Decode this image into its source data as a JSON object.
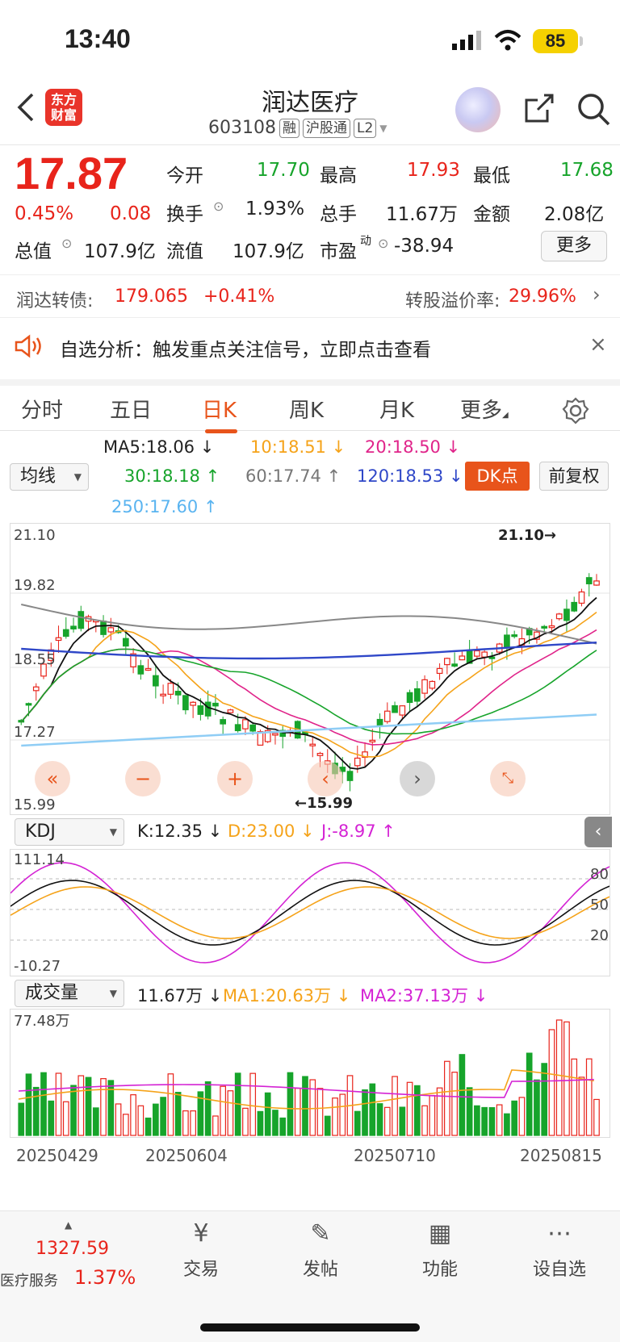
{
  "status": {
    "time": "13:40",
    "battery": "85"
  },
  "header": {
    "logo": [
      "东方",
      "财富"
    ],
    "title": "润达医疗",
    "code": "603108",
    "tags": [
      "融",
      "沪股通",
      "L2"
    ]
  },
  "quote": {
    "price": "17.87",
    "pct": "0.45%",
    "chg": "0.08",
    "open_l": "今开",
    "open": "17.70",
    "high_l": "最高",
    "high": "17.93",
    "low_l": "最低",
    "low": "17.68",
    "turn_l": "换手",
    "turn": "1.93%",
    "vol_l": "总手",
    "vol": "11.67万",
    "amt_l": "金额",
    "amt": "2.08亿",
    "mcap_l": "总值",
    "mcap": "107.9亿",
    "float_l": "流值",
    "float": "107.9亿",
    "pe_l": "市盈",
    "pe_sup": "动",
    "pe": "-38.94",
    "more": "更多"
  },
  "bond": {
    "name": "润达转债:",
    "price": "179.065",
    "chg": "+0.41%",
    "prem_l": "转股溢价率:",
    "prem": "29.96%"
  },
  "alert": {
    "text": "自选分析：触发重点关注信号，立即点击查看"
  },
  "tabs": [
    "分时",
    "五日",
    "日K",
    "周K",
    "月K",
    "更多"
  ],
  "ma": {
    "select": "均线",
    "ma5": "MA5:18.06",
    "ma10": "10:18.51",
    "ma20": "20:18.50",
    "ma30": "30:18.18",
    "ma60": "60:17.74",
    "ma120": "120:18.53",
    "ma250": "250:17.60",
    "dk": "DK点",
    "fq": "前复权"
  },
  "kchart": {
    "ymax": "21.10",
    "y2": "19.82",
    "y3": "18.55",
    "y4": "17.27",
    "ymin": "15.99",
    "hi_lbl": "21.10→",
    "lo_lbl": "←15.99"
  },
  "kdj": {
    "select": "KDJ",
    "k": "K:12.35",
    "d": "D:23.00",
    "j": "J:-8.97",
    "ymax": "111.14",
    "ymin": "-10.27",
    "l80": "80",
    "l50": "50",
    "l20": "20"
  },
  "vol": {
    "select": "成交量",
    "v": "11.67万",
    "ma1": "MA1:20.63万",
    "ma2": "MA2:37.13万",
    "ymax": "77.48万"
  },
  "dates": [
    "20250429",
    "20250604",
    "20250710",
    "20250815"
  ],
  "bottom": {
    "index_val": "1327.59",
    "index_name": "医疗服务",
    "index_pct": "1.37%",
    "items": [
      "交易",
      "发帖",
      "功能",
      "设自选"
    ]
  },
  "chart_data": {
    "type": "candlestick",
    "ylim": [
      15.99,
      21.1
    ],
    "x": [
      "20250429",
      "20250604",
      "20250710",
      "20250815"
    ]
  }
}
